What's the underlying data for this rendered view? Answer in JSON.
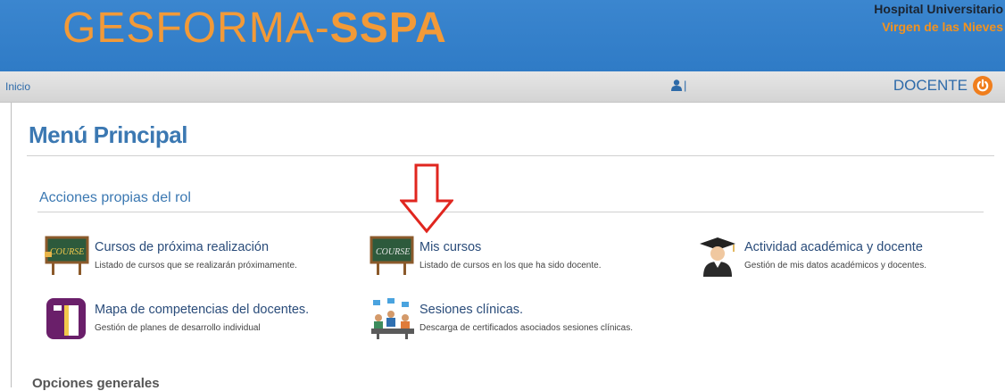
{
  "header": {
    "logo_main": "GESFORMA",
    "logo_sep": "-",
    "logo_accent": "SSPA",
    "hospital_line1": "Hospital Universitario",
    "hospital_line2": "Virgen de las Nieves",
    "bg_color": "#2f7bc6"
  },
  "nav": {
    "inicio": "Inicio",
    "user_separator": "|",
    "role": "DOCENTE"
  },
  "main": {
    "title": "Menú Principal",
    "section_title": "Acciones propias del rol",
    "items": [
      {
        "label": "Cursos de próxima realización",
        "desc": "Listado de cursos que se realizarán próximamente.",
        "icon": "course-board-icon"
      },
      {
        "label": "Mis cursos",
        "desc": "Listado de cursos en los que ha sido docente.",
        "icon": "course-board-icon"
      },
      {
        "label": "Actividad académica y docente",
        "desc": "Gestión de mis datos académicos y docentes.",
        "icon": "graduate-icon"
      },
      {
        "label": "Mapa de competencias del docentes.",
        "desc": "Gestión de planes de desarrollo individual",
        "icon": "competency-map-icon"
      },
      {
        "label": "Sesiones clínicas.",
        "desc": "Descarga de certificados asociados sesiones clínicas.",
        "icon": "meeting-icon"
      }
    ],
    "section2_title": "Opciones generales"
  },
  "colors": {
    "accent_orange": "#f29a38",
    "link_blue": "#3b78b2",
    "arrow_red": "#e0261f"
  }
}
